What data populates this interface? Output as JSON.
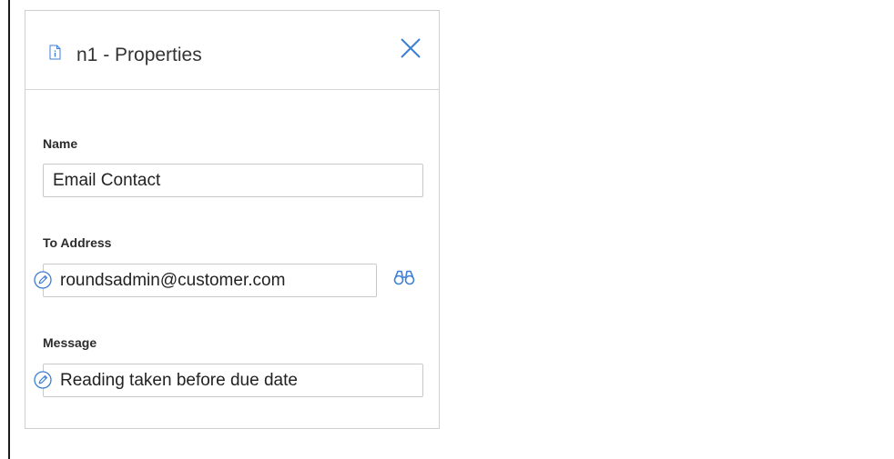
{
  "panel": {
    "title": "n1 - Properties",
    "icon": "document-info-icon",
    "close_icon": "close-icon"
  },
  "fields": {
    "name": {
      "label": "Name",
      "value": "Email Contact"
    },
    "to_address": {
      "label": "To Address",
      "value": "roundsadmin@customer.com",
      "edit_icon": "pencil-icon",
      "lookup_icon": "binoculars-icon"
    },
    "message": {
      "label": "Message",
      "value": "Reading taken before due date",
      "edit_icon": "pencil-icon"
    }
  },
  "colors": {
    "accent": "#3d7fd6",
    "border": "#c9c9c9",
    "text": "#222222"
  }
}
